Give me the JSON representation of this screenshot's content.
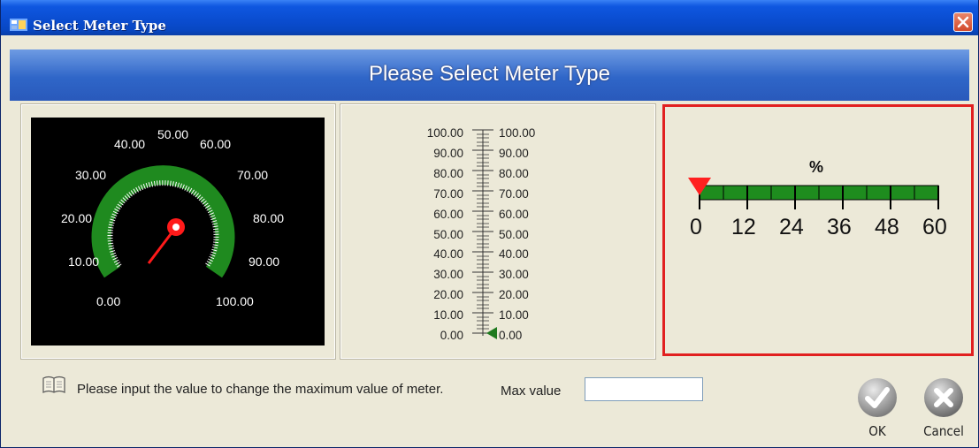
{
  "window": {
    "title": "Select Meter Type",
    "close_label": "×"
  },
  "banner": {
    "text": "Please Select Meter Type"
  },
  "dial_meter": {
    "labels": [
      "0.00",
      "10.00",
      "20.00",
      "30.00",
      "40.00",
      "50.00",
      "60.00",
      "70.00",
      "80.00",
      "90.00",
      "100.00"
    ],
    "colors": {
      "background": "#000000",
      "arc": "#1f8a1f",
      "needle": "#ff0000"
    }
  },
  "vertical_meter": {
    "labels": [
      "100.00",
      "90.00",
      "80.00",
      "70.00",
      "60.00",
      "50.00",
      "40.00",
      "30.00",
      "20.00",
      "10.00",
      "0.00"
    ],
    "pointer_color": "#1f7a1f"
  },
  "bar_meter": {
    "unit": "%",
    "labels": [
      "0",
      "12",
      "24",
      "36",
      "48",
      "60"
    ],
    "colors": {
      "bar": "#1e8c1e",
      "pointer": "#ff2020"
    },
    "selected": true
  },
  "footer": {
    "hint_text": "Please input the value to change the maximum value of meter.",
    "max_value_label": "Max value",
    "max_value": "",
    "ok_label": "OK",
    "cancel_label": "Cancel"
  }
}
